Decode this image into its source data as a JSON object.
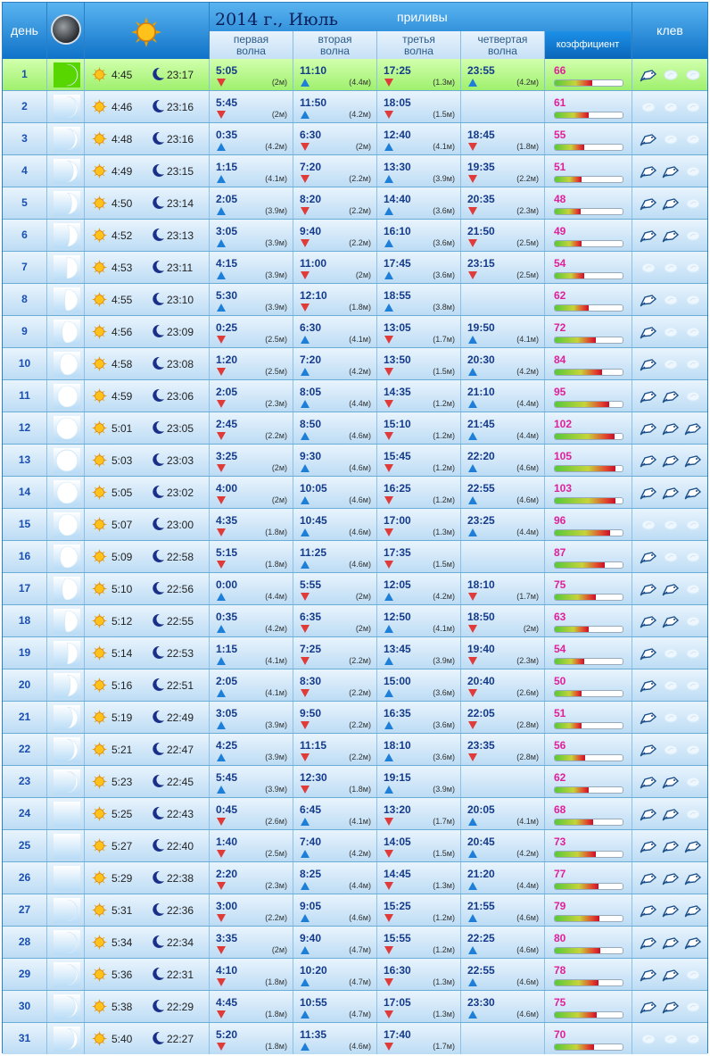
{
  "header": {
    "day_label": "день",
    "title": "2014 г., Июль",
    "tides_label": "приливы",
    "wave1_line1": "первая",
    "wave1_line2": "волна",
    "wave2_line1": "вторая",
    "wave2_line2": "волна",
    "wave3_line1": "третья",
    "wave3_line2": "волна",
    "wave4_line1": "четвертая",
    "wave4_line2": "волна",
    "coef_label": "коэффициент",
    "bite_label": "клев"
  },
  "colors": {
    "high_tide": "#1d7fd8",
    "low_tide": "#e03a3a",
    "coef_text": "#e0209a",
    "today_bg": "#a6f06e"
  },
  "days": [
    {
      "day": "1",
      "sunrise": "4:45",
      "moonrise": "23:17",
      "today": true,
      "moon_phase": 0.02,
      "tides": [
        {
          "time": "5:05",
          "dir": "down",
          "h": "(2м)"
        },
        {
          "time": "11:10",
          "dir": "up",
          "h": "(4.4м)"
        },
        {
          "time": "17:25",
          "dir": "down",
          "h": "(1.3м)"
        },
        {
          "time": "23:55",
          "dir": "up",
          "h": "(4.2м)"
        }
      ],
      "coef": "66",
      "coef_frac": 0.55,
      "bite": 1
    },
    {
      "day": "2",
      "sunrise": "4:46",
      "moonrise": "23:16",
      "moon_phase": 0.06,
      "tides": [
        {
          "time": "5:45",
          "dir": "down",
          "h": "(2м)"
        },
        {
          "time": "11:50",
          "dir": "up",
          "h": "(4.2м)"
        },
        {
          "time": "18:05",
          "dir": "down",
          "h": "(1.5м)"
        },
        null
      ],
      "coef": "61",
      "coef_frac": 0.5,
      "bite": 0
    },
    {
      "day": "3",
      "sunrise": "4:48",
      "moonrise": "23:16",
      "moon_phase": 0.12,
      "tides": [
        {
          "time": "0:35",
          "dir": "up",
          "h": "(4.2м)"
        },
        {
          "time": "6:30",
          "dir": "down",
          "h": "(2м)"
        },
        {
          "time": "12:40",
          "dir": "up",
          "h": "(4.1м)"
        },
        {
          "time": "18:45",
          "dir": "down",
          "h": "(1.8м)"
        }
      ],
      "coef": "55",
      "coef_frac": 0.44,
      "bite": 1
    },
    {
      "day": "4",
      "sunrise": "4:49",
      "moonrise": "23:15",
      "moon_phase": 0.2,
      "tides": [
        {
          "time": "1:15",
          "dir": "up",
          "h": "(4.1м)"
        },
        {
          "time": "7:20",
          "dir": "down",
          "h": "(2.2м)"
        },
        {
          "time": "13:30",
          "dir": "up",
          "h": "(3.9м)"
        },
        {
          "time": "19:35",
          "dir": "down",
          "h": "(2.2м)"
        }
      ],
      "coef": "51",
      "coef_frac": 0.4,
      "bite": 2
    },
    {
      "day": "5",
      "sunrise": "4:50",
      "moonrise": "23:14",
      "moon_phase": 0.28,
      "tides": [
        {
          "time": "2:05",
          "dir": "up",
          "h": "(3.9м)"
        },
        {
          "time": "8:20",
          "dir": "down",
          "h": "(2.2м)"
        },
        {
          "time": "14:40",
          "dir": "up",
          "h": "(3.6м)"
        },
        {
          "time": "20:35",
          "dir": "down",
          "h": "(2.3м)"
        }
      ],
      "coef": "48",
      "coef_frac": 0.38,
      "bite": 2
    },
    {
      "day": "6",
      "sunrise": "4:52",
      "moonrise": "23:13",
      "moon_phase": 0.38,
      "tides": [
        {
          "time": "3:05",
          "dir": "up",
          "h": "(3.9м)"
        },
        {
          "time": "9:40",
          "dir": "down",
          "h": "(2.2м)"
        },
        {
          "time": "16:10",
          "dir": "up",
          "h": "(3.6м)"
        },
        {
          "time": "21:50",
          "dir": "down",
          "h": "(2.5м)"
        }
      ],
      "coef": "49",
      "coef_frac": 0.39,
      "bite": 2
    },
    {
      "day": "7",
      "sunrise": "4:53",
      "moonrise": "23:11",
      "moon_phase": 0.5,
      "tides": [
        {
          "time": "4:15",
          "dir": "up",
          "h": "(3.9м)"
        },
        {
          "time": "11:00",
          "dir": "down",
          "h": "(2м)"
        },
        {
          "time": "17:45",
          "dir": "up",
          "h": "(3.6м)"
        },
        {
          "time": "23:15",
          "dir": "down",
          "h": "(2.5м)"
        }
      ],
      "coef": "54",
      "coef_frac": 0.43,
      "bite": 0
    },
    {
      "day": "8",
      "sunrise": "4:55",
      "moonrise": "23:10",
      "moon_phase": 0.6,
      "tides": [
        {
          "time": "5:30",
          "dir": "up",
          "h": "(3.9м)"
        },
        {
          "time": "12:10",
          "dir": "down",
          "h": "(1.8м)"
        },
        {
          "time": "18:55",
          "dir": "up",
          "h": "(3.8м)"
        },
        null
      ],
      "coef": "62",
      "coef_frac": 0.5,
      "bite": 1
    },
    {
      "day": "9",
      "sunrise": "4:56",
      "moonrise": "23:09",
      "moon_phase": 0.72,
      "tides": [
        {
          "time": "0:25",
          "dir": "down",
          "h": "(2.5м)"
        },
        {
          "time": "6:30",
          "dir": "up",
          "h": "(4.1м)"
        },
        {
          "time": "13:05",
          "dir": "down",
          "h": "(1.7м)"
        },
        {
          "time": "19:50",
          "dir": "up",
          "h": "(4.1м)"
        }
      ],
      "coef": "72",
      "coef_frac": 0.6,
      "bite": 1
    },
    {
      "day": "10",
      "sunrise": "4:58",
      "moonrise": "23:08",
      "moon_phase": 0.82,
      "tides": [
        {
          "time": "1:20",
          "dir": "down",
          "h": "(2.5м)"
        },
        {
          "time": "7:20",
          "dir": "up",
          "h": "(4.2м)"
        },
        {
          "time": "13:50",
          "dir": "down",
          "h": "(1.5м)"
        },
        {
          "time": "20:30",
          "dir": "up",
          "h": "(4.2м)"
        }
      ],
      "coef": "84",
      "coef_frac": 0.7,
      "bite": 1
    },
    {
      "day": "11",
      "sunrise": "4:59",
      "moonrise": "23:06",
      "moon_phase": 0.92,
      "tides": [
        {
          "time": "2:05",
          "dir": "down",
          "h": "(2.3м)"
        },
        {
          "time": "8:05",
          "dir": "up",
          "h": "(4.4м)"
        },
        {
          "time": "14:35",
          "dir": "down",
          "h": "(1.2м)"
        },
        {
          "time": "21:10",
          "dir": "up",
          "h": "(4.4м)"
        }
      ],
      "coef": "95",
      "coef_frac": 0.8,
      "bite": 2
    },
    {
      "day": "12",
      "sunrise": "5:01",
      "moonrise": "23:05",
      "moon_phase": 0.98,
      "tides": [
        {
          "time": "2:45",
          "dir": "down",
          "h": "(2.2м)"
        },
        {
          "time": "8:50",
          "dir": "up",
          "h": "(4.6м)"
        },
        {
          "time": "15:10",
          "dir": "down",
          "h": "(1.2м)"
        },
        {
          "time": "21:45",
          "dir": "up",
          "h": "(4.4м)"
        }
      ],
      "coef": "102",
      "coef_frac": 0.88,
      "bite": 3
    },
    {
      "day": "13",
      "sunrise": "5:03",
      "moonrise": "23:03",
      "moon_phase": 1.0,
      "tides": [
        {
          "time": "3:25",
          "dir": "down",
          "h": "(2м)"
        },
        {
          "time": "9:30",
          "dir": "up",
          "h": "(4.6м)"
        },
        {
          "time": "15:45",
          "dir": "down",
          "h": "(1.2м)"
        },
        {
          "time": "22:20",
          "dir": "up",
          "h": "(4.6м)"
        }
      ],
      "coef": "105",
      "coef_frac": 0.9,
      "bite": 3
    },
    {
      "day": "14",
      "sunrise": "5:05",
      "moonrise": "23:02",
      "moon_phase": 0.96,
      "tides": [
        {
          "time": "4:00",
          "dir": "down",
          "h": "(2м)"
        },
        {
          "time": "10:05",
          "dir": "up",
          "h": "(4.6м)"
        },
        {
          "time": "16:25",
          "dir": "down",
          "h": "(1.2м)"
        },
        {
          "time": "22:55",
          "dir": "up",
          "h": "(4.6м)"
        }
      ],
      "coef": "103",
      "coef_frac": 0.89,
      "bite": 3
    },
    {
      "day": "15",
      "sunrise": "5:07",
      "moonrise": "23:00",
      "moon_phase": 0.9,
      "tides": [
        {
          "time": "4:35",
          "dir": "down",
          "h": "(1.8м)"
        },
        {
          "time": "10:45",
          "dir": "up",
          "h": "(4.6м)"
        },
        {
          "time": "17:00",
          "dir": "down",
          "h": "(1.3м)"
        },
        {
          "time": "23:25",
          "dir": "up",
          "h": "(4.4м)"
        }
      ],
      "coef": "96",
      "coef_frac": 0.82,
      "bite": 0
    },
    {
      "day": "16",
      "sunrise": "5:09",
      "moonrise": "22:58",
      "moon_phase": 0.82,
      "tides": [
        {
          "time": "5:15",
          "dir": "down",
          "h": "(1.8м)"
        },
        {
          "time": "11:25",
          "dir": "up",
          "h": "(4.6м)"
        },
        {
          "time": "17:35",
          "dir": "down",
          "h": "(1.5м)"
        },
        null
      ],
      "coef": "87",
      "coef_frac": 0.74,
      "bite": 1
    },
    {
      "day": "17",
      "sunrise": "5:10",
      "moonrise": "22:56",
      "moon_phase": 0.72,
      "tides": [
        {
          "time": "0:00",
          "dir": "up",
          "h": "(4.4м)"
        },
        {
          "time": "5:55",
          "dir": "down",
          "h": "(2м)"
        },
        {
          "time": "12:05",
          "dir": "up",
          "h": "(4.2м)"
        },
        {
          "time": "18:10",
          "dir": "down",
          "h": "(1.7м)"
        }
      ],
      "coef": "75",
      "coef_frac": 0.6,
      "bite": 2
    },
    {
      "day": "18",
      "sunrise": "5:12",
      "moonrise": "22:55",
      "moon_phase": 0.6,
      "tides": [
        {
          "time": "0:35",
          "dir": "up",
          "h": "(4.2м)"
        },
        {
          "time": "6:35",
          "dir": "down",
          "h": "(2м)"
        },
        {
          "time": "12:50",
          "dir": "up",
          "h": "(4.1м)"
        },
        {
          "time": "18:50",
          "dir": "down",
          "h": "(2м)"
        }
      ],
      "coef": "63",
      "coef_frac": 0.5,
      "bite": 2
    },
    {
      "day": "19",
      "sunrise": "5:14",
      "moonrise": "22:53",
      "moon_phase": 0.45,
      "tides": [
        {
          "time": "1:15",
          "dir": "up",
          "h": "(4.1м)"
        },
        {
          "time": "7:25",
          "dir": "down",
          "h": "(2.2м)"
        },
        {
          "time": "13:45",
          "dir": "up",
          "h": "(3.9м)"
        },
        {
          "time": "19:40",
          "dir": "down",
          "h": "(2.3м)"
        }
      ],
      "coef": "54",
      "coef_frac": 0.43,
      "bite": 1
    },
    {
      "day": "20",
      "sunrise": "5:16",
      "moonrise": "22:51",
      "moon_phase": 0.34,
      "tides": [
        {
          "time": "2:05",
          "dir": "up",
          "h": "(4.1м)"
        },
        {
          "time": "8:30",
          "dir": "down",
          "h": "(2.2м)"
        },
        {
          "time": "15:00",
          "dir": "up",
          "h": "(3.6м)"
        },
        {
          "time": "20:40",
          "dir": "down",
          "h": "(2.6м)"
        }
      ],
      "coef": "50",
      "coef_frac": 0.39,
      "bite": 1
    },
    {
      "day": "21",
      "sunrise": "5:19",
      "moonrise": "22:49",
      "moon_phase": 0.24,
      "tides": [
        {
          "time": "3:05",
          "dir": "up",
          "h": "(3.9м)"
        },
        {
          "time": "9:50",
          "dir": "down",
          "h": "(2.2м)"
        },
        {
          "time": "16:35",
          "dir": "up",
          "h": "(3.6м)"
        },
        {
          "time": "22:05",
          "dir": "down",
          "h": "(2.8м)"
        }
      ],
      "coef": "51",
      "coef_frac": 0.4,
      "bite": 1
    },
    {
      "day": "22",
      "sunrise": "5:21",
      "moonrise": "22:47",
      "moon_phase": 0.16,
      "tides": [
        {
          "time": "4:25",
          "dir": "up",
          "h": "(3.9м)"
        },
        {
          "time": "11:15",
          "dir": "down",
          "h": "(2.2м)"
        },
        {
          "time": "18:10",
          "dir": "up",
          "h": "(3.6м)"
        },
        {
          "time": "23:35",
          "dir": "down",
          "h": "(2.8м)"
        }
      ],
      "coef": "56",
      "coef_frac": 0.45,
      "bite": 1
    },
    {
      "day": "23",
      "sunrise": "5:23",
      "moonrise": "22:45",
      "moon_phase": 0.08,
      "tides": [
        {
          "time": "5:45",
          "dir": "up",
          "h": "(3.9м)"
        },
        {
          "time": "12:30",
          "dir": "down",
          "h": "(1.8м)"
        },
        {
          "time": "19:15",
          "dir": "up",
          "h": "(3.9м)"
        },
        null
      ],
      "coef": "62",
      "coef_frac": 0.5,
      "bite": 2
    },
    {
      "day": "24",
      "sunrise": "5:25",
      "moonrise": "22:43",
      "moon_phase": 0.0,
      "tides": [
        {
          "time": "0:45",
          "dir": "down",
          "h": "(2.6м)"
        },
        {
          "time": "6:45",
          "dir": "up",
          "h": "(4.1м)"
        },
        {
          "time": "13:20",
          "dir": "down",
          "h": "(1.7м)"
        },
        {
          "time": "20:05",
          "dir": "up",
          "h": "(4.1м)"
        }
      ],
      "coef": "68",
      "coef_frac": 0.56,
      "bite": 2
    },
    {
      "day": "25",
      "sunrise": "5:27",
      "moonrise": "22:40",
      "moon_phase": 0.0,
      "tides": [
        {
          "time": "1:40",
          "dir": "down",
          "h": "(2.5м)"
        },
        {
          "time": "7:40",
          "dir": "up",
          "h": "(4.2м)"
        },
        {
          "time": "14:05",
          "dir": "down",
          "h": "(1.5м)"
        },
        {
          "time": "20:45",
          "dir": "up",
          "h": "(4.2м)"
        }
      ],
      "coef": "73",
      "coef_frac": 0.61,
      "bite": 3
    },
    {
      "day": "26",
      "sunrise": "5:29",
      "moonrise": "22:38",
      "moon_phase": 0.0,
      "tides": [
        {
          "time": "2:20",
          "dir": "down",
          "h": "(2.3м)"
        },
        {
          "time": "8:25",
          "dir": "up",
          "h": "(4.4м)"
        },
        {
          "time": "14:45",
          "dir": "down",
          "h": "(1.3м)"
        },
        {
          "time": "21:20",
          "dir": "up",
          "h": "(4.4м)"
        }
      ],
      "coef": "77",
      "coef_frac": 0.64,
      "bite": 3
    },
    {
      "day": "27",
      "sunrise": "5:31",
      "moonrise": "22:36",
      "moon_phase": 0.02,
      "tides": [
        {
          "time": "3:00",
          "dir": "down",
          "h": "(2.2м)"
        },
        {
          "time": "9:05",
          "dir": "up",
          "h": "(4.6м)"
        },
        {
          "time": "15:25",
          "dir": "down",
          "h": "(1.2м)"
        },
        {
          "time": "21:55",
          "dir": "up",
          "h": "(4.6м)"
        }
      ],
      "coef": "79",
      "coef_frac": 0.66,
      "bite": 3
    },
    {
      "day": "28",
      "sunrise": "5:34",
      "moonrise": "22:34",
      "moon_phase": 0.04,
      "tides": [
        {
          "time": "3:35",
          "dir": "down",
          "h": "(2м)"
        },
        {
          "time": "9:40",
          "dir": "up",
          "h": "(4.7м)"
        },
        {
          "time": "15:55",
          "dir": "down",
          "h": "(1.2м)"
        },
        {
          "time": "22:25",
          "dir": "up",
          "h": "(4.6м)"
        }
      ],
      "coef": "80",
      "coef_frac": 0.67,
      "bite": 3
    },
    {
      "day": "29",
      "sunrise": "5:36",
      "moonrise": "22:31",
      "moon_phase": 0.06,
      "tides": [
        {
          "time": "4:10",
          "dir": "down",
          "h": "(1.8м)"
        },
        {
          "time": "10:20",
          "dir": "up",
          "h": "(4.7м)"
        },
        {
          "time": "16:30",
          "dir": "down",
          "h": "(1.3м)"
        },
        {
          "time": "22:55",
          "dir": "up",
          "h": "(4.6м)"
        }
      ],
      "coef": "78",
      "coef_frac": 0.65,
      "bite": 2
    },
    {
      "day": "30",
      "sunrise": "5:38",
      "moonrise": "22:29",
      "moon_phase": 0.1,
      "tides": [
        {
          "time": "4:45",
          "dir": "down",
          "h": "(1.8м)"
        },
        {
          "time": "10:55",
          "dir": "up",
          "h": "(4.7м)"
        },
        {
          "time": "17:05",
          "dir": "down",
          "h": "(1.3м)"
        },
        {
          "time": "23:30",
          "dir": "up",
          "h": "(4.6м)"
        }
      ],
      "coef": "75",
      "coef_frac": 0.62,
      "bite": 2
    },
    {
      "day": "31",
      "sunrise": "5:40",
      "moonrise": "22:27",
      "moon_phase": 0.16,
      "tides": [
        {
          "time": "5:20",
          "dir": "down",
          "h": "(1.8м)"
        },
        {
          "time": "11:35",
          "dir": "up",
          "h": "(4.6м)"
        },
        {
          "time": "17:40",
          "dir": "down",
          "h": "(1.7м)"
        },
        null
      ],
      "coef": "70",
      "coef_frac": 0.58,
      "bite": 0
    }
  ]
}
